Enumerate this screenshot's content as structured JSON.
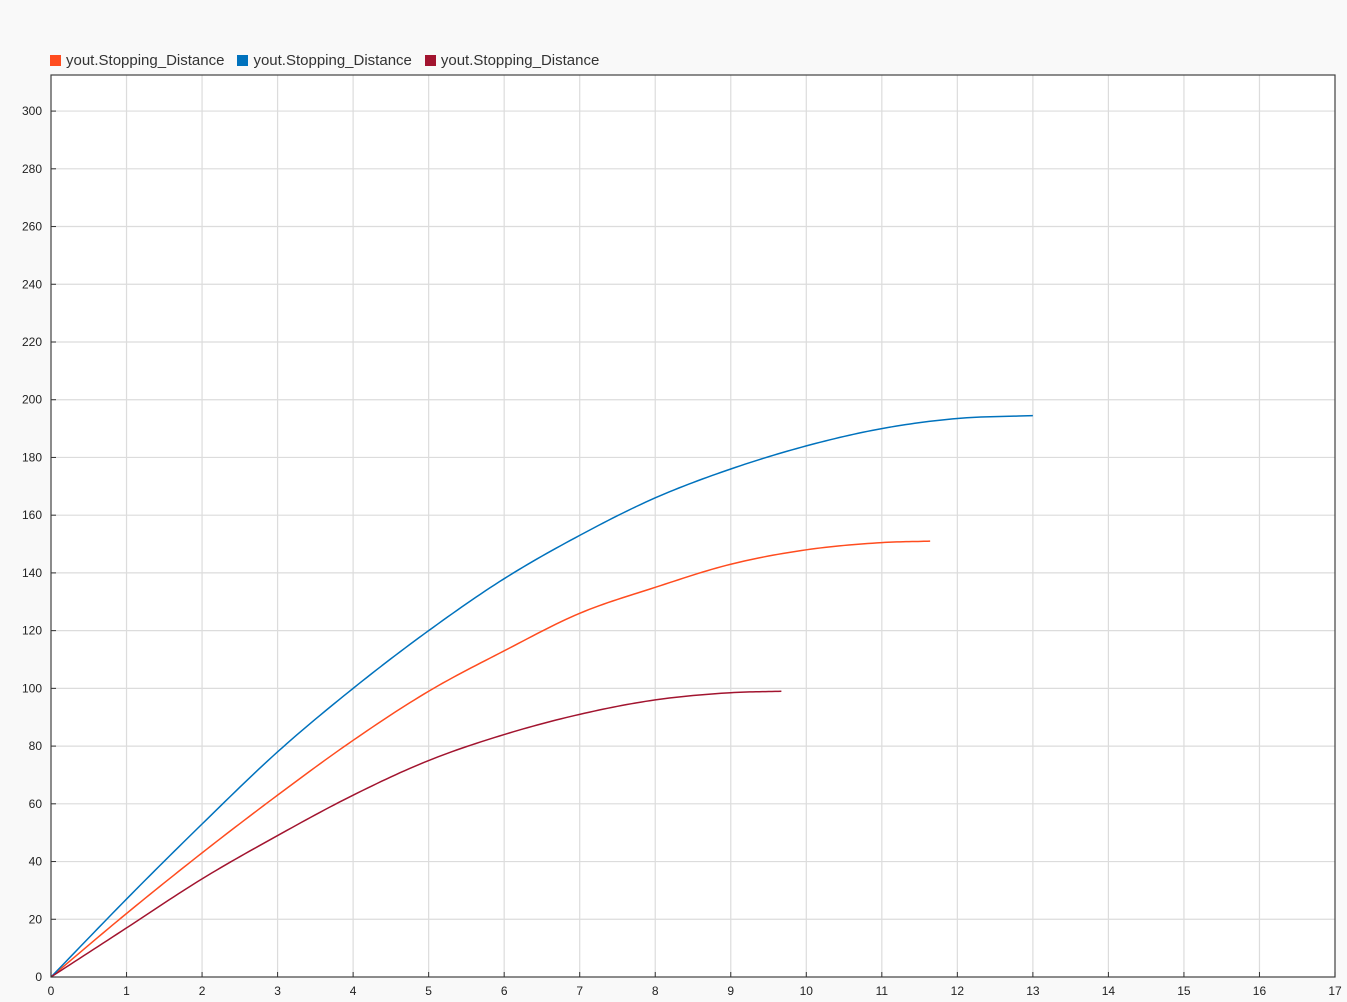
{
  "chart_data": {
    "type": "line",
    "title": "",
    "xlabel": "",
    "ylabel": "",
    "xlim": [
      0,
      17
    ],
    "ylim": [
      0,
      312.5
    ],
    "grid": true,
    "legend_position": "top-left",
    "x_ticks": [
      "0",
      "1",
      "2",
      "3",
      "4",
      "5",
      "6",
      "7",
      "8",
      "9",
      "10",
      "11",
      "12",
      "13",
      "14",
      "15",
      "16",
      "17"
    ],
    "y_ticks": [
      "0",
      "20",
      "40",
      "60",
      "80",
      "100",
      "120",
      "140",
      "160",
      "180",
      "200",
      "220",
      "240",
      "260",
      "280",
      "300"
    ],
    "series": [
      {
        "name": "yout.Stopping_Distance",
        "color": "#ff4c1f",
        "x": [
          0,
          1,
          2,
          3,
          4,
          5,
          6,
          7,
          8,
          9,
          10,
          11,
          11.64
        ],
        "y": [
          0,
          22,
          43,
          63,
          82,
          99,
          113,
          126,
          135,
          143,
          148,
          150.5,
          151
        ]
      },
      {
        "name": "yout.Stopping_Distance",
        "color": "#0072bd",
        "x": [
          0,
          1,
          2,
          3,
          4,
          5,
          6,
          7,
          8,
          9,
          10,
          11,
          12,
          13
        ],
        "y": [
          0,
          27,
          53,
          78,
          100,
          120,
          138,
          153,
          166,
          176,
          184,
          190,
          193.5,
          194.5
        ]
      },
      {
        "name": "yout.Stopping_Distance",
        "color": "#a2142f",
        "x": [
          0,
          1,
          2,
          3,
          4,
          5,
          6,
          7,
          8,
          9,
          9.67
        ],
        "y": [
          0,
          17,
          34,
          49,
          63,
          75,
          84,
          91,
          96,
          98.5,
          99
        ]
      }
    ]
  }
}
